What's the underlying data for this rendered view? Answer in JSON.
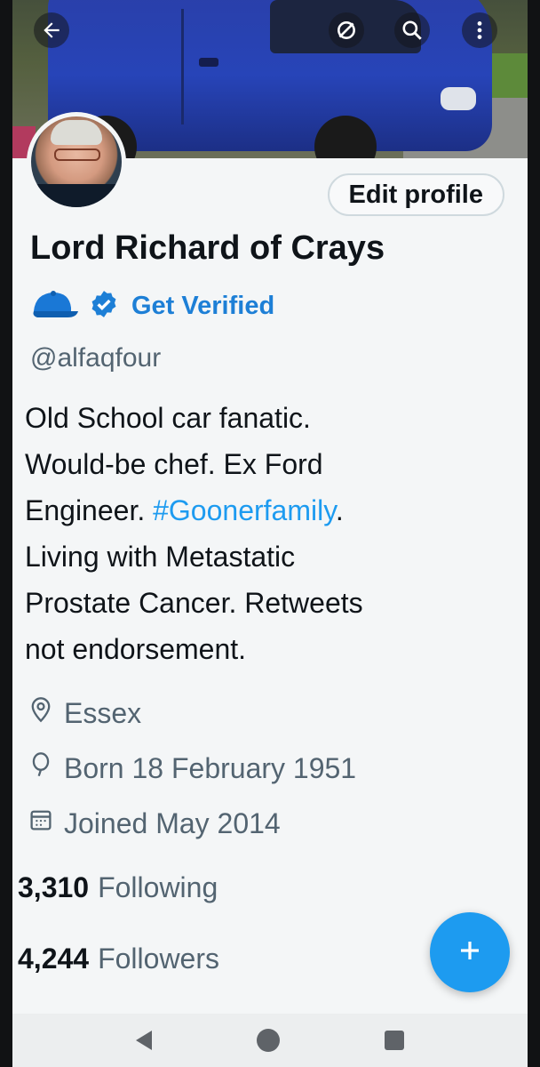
{
  "header": {
    "back_icon": "arrow-left-icon",
    "mute_icon": "slashed-circle-icon",
    "search_icon": "search-icon",
    "more_icon": "kebab-menu-icon"
  },
  "profile": {
    "edit_label": "Edit profile",
    "name": "Lord Richard of Crays",
    "verify_label": "Get Verified",
    "handle": "@alfaqfour",
    "bio_lines": [
      "Old School car fanatic.",
      "Would-be chef. Ex Ford",
      "Engineer. ",
      "Living with Metastatic",
      "Prostate Cancer. Retweets",
      "not endorsement."
    ],
    "bio_hashtag": "#Goonerfamily",
    "bio_after_hashtag": ".",
    "location": "Essex",
    "birthday": "Born 18 February 1951",
    "joined": "Joined May 2014",
    "following_count": "3,310",
    "following_label": "Following",
    "followers_count": "4,244",
    "followers_label": "Followers"
  },
  "colors": {
    "accent": "#1d9bf0",
    "verify_blue": "#1d7fd6",
    "text_primary": "#0f1419",
    "text_secondary": "#536471"
  }
}
